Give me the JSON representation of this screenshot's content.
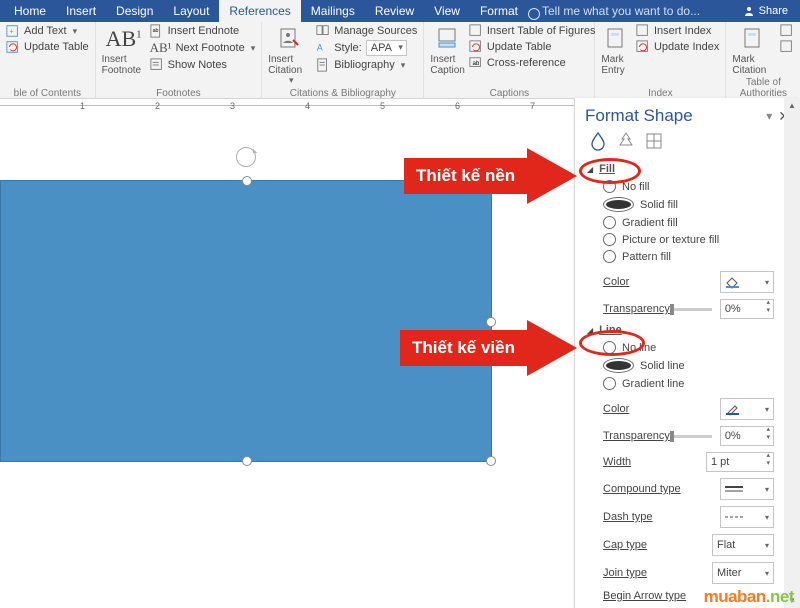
{
  "tabs": [
    "Home",
    "Insert",
    "Design",
    "Layout",
    "References",
    "Mailings",
    "Review",
    "View",
    "Format"
  ],
  "active_tab": "References",
  "tell_me": "Tell me what you want to do...",
  "share": "Share",
  "toc_group": {
    "addText": "Add Text",
    "updateTable": "Update Table",
    "title": "ble of Contents"
  },
  "footnotes": {
    "btn": "Insert Footnote",
    "endnote": "Insert Endnote",
    "next": "Next Footnote",
    "show": "Show Notes",
    "title": "Footnotes"
  },
  "citations": {
    "btn": "Insert Citation",
    "manage": "Manage Sources",
    "style": "Style:",
    "styleVal": "APA",
    "bib": "Bibliography",
    "title": "Citations & Bibliography"
  },
  "captions": {
    "btn": "Insert Caption",
    "tof": "Insert Table of Figures",
    "upd": "Update Table",
    "cross": "Cross-reference",
    "title": "Captions"
  },
  "index": {
    "btn": "Mark Entry",
    "ins": "Insert Index",
    "upd": "Update Index",
    "title": "Index"
  },
  "toa": {
    "btn": "Mark Citation",
    "title": "Table of Authorities"
  },
  "ruler_nums": [
    "1",
    "2",
    "3",
    "4",
    "5",
    "6",
    "7"
  ],
  "pane": {
    "title": "Format Shape",
    "fill": {
      "hd": "Fill",
      "opts": [
        "No fill",
        "Solid fill",
        "Gradient fill",
        "Picture or texture fill",
        "Pattern fill"
      ],
      "selected": 1,
      "color": "Color",
      "trans": "Transparency",
      "transVal": "0%"
    },
    "line": {
      "hd": "Line",
      "opts": [
        "No line",
        "Solid line",
        "Gradient line"
      ],
      "selected": 1,
      "color": "Color",
      "trans": "Transparency",
      "transVal": "0%",
      "width": "Width",
      "widthVal": "1 pt",
      "compound": "Compound type",
      "dash": "Dash type",
      "cap": "Cap type",
      "capVal": "Flat",
      "join": "Join type",
      "joinVal": "Miter",
      "barrow": "Begin Arrow type"
    }
  },
  "callouts": {
    "fill": "Thiết kế nền",
    "line": "Thiết kế viền"
  },
  "watermark": "muaban.net"
}
